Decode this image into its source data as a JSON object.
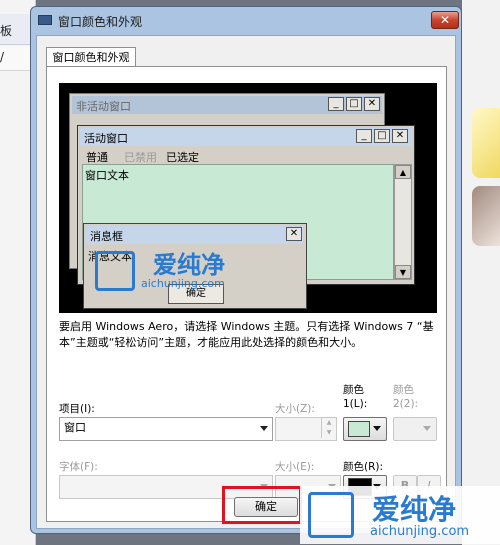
{
  "background": {
    "left_text_1": "板",
    "left_text_2": "/"
  },
  "dialog": {
    "title": "窗口颜色和外观",
    "close_glyph": "✕",
    "tab_label": "窗口颜色和外观"
  },
  "preview": {
    "inactive_window_title": "非活动窗口",
    "active_window_title": "活动窗口",
    "menu": {
      "normal": "普通",
      "disabled": "已禁用",
      "selected": "已选定"
    },
    "window_text": "窗口文本",
    "message_box_title": "消息框",
    "message_text": "消息文本",
    "message_ok": "确定",
    "caption_buttons": {
      "minimize": "_",
      "maximize": "□",
      "close": "✕"
    }
  },
  "description": "要启用 Windows Aero，请选择 Windows 主题。只有选择 Windows 7 “基本”主题或“轻松访问”主题，才能应用此处选择的颜色和大小。",
  "controls": {
    "item_label": "项目(I):",
    "item_value": "窗口",
    "size_label": "大小(Z):",
    "color1_label": "颜色 1(L):",
    "color2_label": "颜色 2(2):",
    "font_label": "字体(F):",
    "font_size_label": "大小(E):",
    "font_color_label": "颜色(R):",
    "bold": "B",
    "italic": "I",
    "color1_value": "#c8ead4",
    "font_color_value": "#000000"
  },
  "buttons": {
    "ok": "确定"
  },
  "watermark": {
    "cn": "爱纯净",
    "en": "aichunjing.com"
  },
  "colors": {
    "title_bar": "#aac4e2",
    "highlight_outline": "#e0141e",
    "window_text_bg": "#c8ead4"
  }
}
